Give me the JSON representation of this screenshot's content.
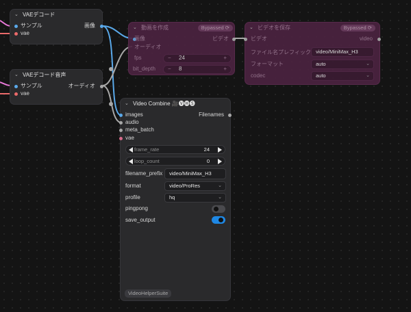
{
  "colors": {
    "wire_blue": "#5aa9ea",
    "wire_grey": "#a8a8a8",
    "wire_red": "#ea6a6a",
    "toggle_on": "#1e88e5",
    "toggle_off": "#4a4a4e"
  },
  "vae_decode": {
    "title": "VAEデコード",
    "inputs": [
      "サンプル",
      "vae"
    ],
    "output": "画像"
  },
  "vae_decode_audio": {
    "title": "VAEデコード音声",
    "inputs": [
      "サンプル",
      "vae"
    ],
    "output": "オーディオ"
  },
  "create_video": {
    "title": "動画を作成",
    "badge": "Bypassed ⟳",
    "inputs": [
      "画像",
      "オーディオ"
    ],
    "output": "ビデオ",
    "fps": {
      "label": "fps",
      "value": "24",
      "minus": "−",
      "plus": "+"
    },
    "bit_depth": {
      "label": "bit_depth",
      "value": "8",
      "minus": "−",
      "plus": "+"
    }
  },
  "save_video": {
    "title": "ビデオを保存",
    "badge": "Bypassed ⟳",
    "input": "ビデオ",
    "output": "video",
    "filename_prefix": {
      "label": "ファイル名プレフィックス",
      "value": "video/MiniMax_H3"
    },
    "format": {
      "label": "フォーマット",
      "value": "auto"
    },
    "codec": {
      "label": "codec",
      "value": "auto"
    }
  },
  "video_combine": {
    "title": "Video Combine 🎥🅥🅗🅢",
    "output": "Filenames",
    "inputs": [
      "images",
      "audio",
      "meta_batch",
      "vae"
    ],
    "frame_rate": {
      "label": "frame_rate",
      "value": "24"
    },
    "loop_count": {
      "label": "loop_count",
      "value": "0"
    },
    "filename_prefix": {
      "label": "filename_prefix",
      "value": "video/MiniMax_H3"
    },
    "format": {
      "label": "format",
      "value": "video/ProRes"
    },
    "profile": {
      "label": "profile",
      "value": "hq"
    },
    "pingpong": {
      "label": "pingpong",
      "on": false
    },
    "save_output": {
      "label": "save_output",
      "on": true
    },
    "footer_tag": "VideoHelperSuite"
  }
}
